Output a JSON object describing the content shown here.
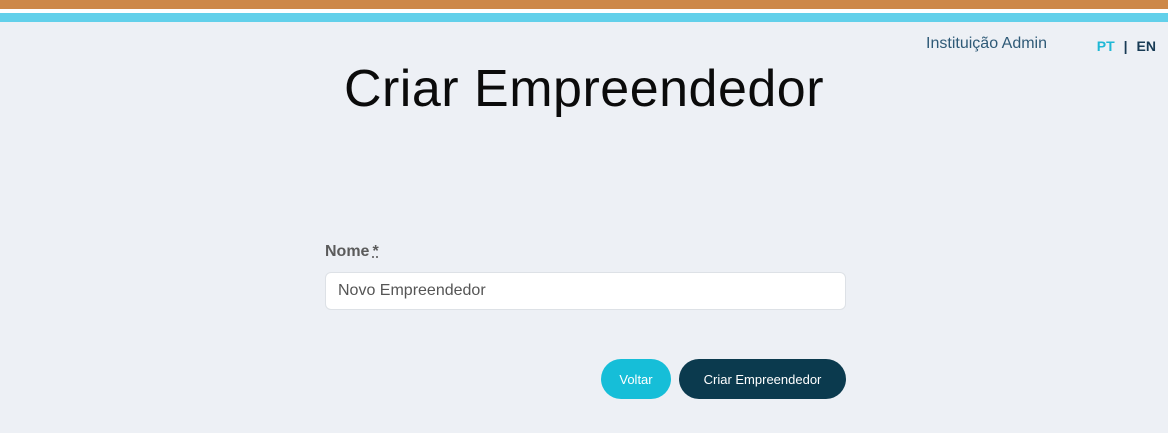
{
  "header": {
    "user_link": "Instituição Admin",
    "lang_pt": "PT",
    "lang_separator": "|",
    "lang_en": "EN",
    "colors": {
      "stripe_top": "#cd8848",
      "stripe_bottom": "#62d0ea"
    }
  },
  "page": {
    "title": "Criar Empreendedor"
  },
  "form": {
    "name_label": "Nome",
    "required_marker": "*",
    "name_value": "Novo Empreendedor"
  },
  "actions": {
    "back_label": "Voltar",
    "create_label": "Criar Empreendedor",
    "colors": {
      "back": "#16bed8",
      "create": "#0b3a4e"
    }
  }
}
